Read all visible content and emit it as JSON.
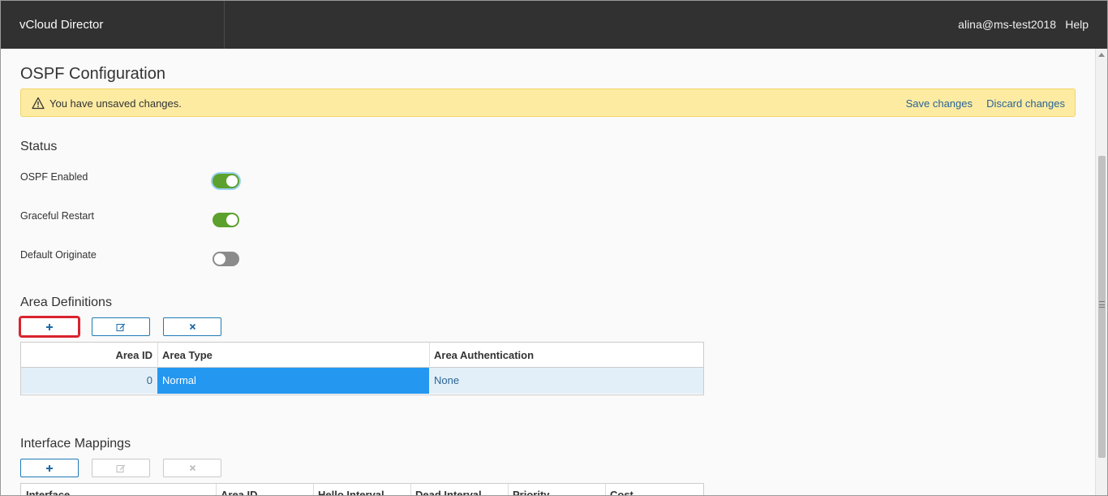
{
  "header": {
    "app_title": "vCloud Director",
    "user": "alina@ms-test2018",
    "help_label": "Help"
  },
  "page": {
    "title": "OSPF Configuration"
  },
  "alert": {
    "message": "You have unsaved changes.",
    "save_label": "Save changes",
    "discard_label": "Discard changes",
    "icon": "warning-icon"
  },
  "status": {
    "title": "Status",
    "ospf_enabled": {
      "label": "OSPF Enabled",
      "on": true
    },
    "graceful_restart": {
      "label": "Graceful Restart",
      "on": true
    },
    "default_originate": {
      "label": "Default Originate",
      "on": false
    }
  },
  "area_definitions": {
    "title": "Area Definitions",
    "columns": [
      "Area ID",
      "Area Type",
      "Area Authentication"
    ],
    "rows": [
      {
        "area_id": "0",
        "area_type": "Normal",
        "area_auth": "None"
      }
    ]
  },
  "interface_mappings": {
    "title": "Interface Mappings",
    "columns": [
      "Interface",
      "Area ID",
      "Hello Interval",
      "Dead Interval",
      "Priority",
      "Cost"
    ]
  },
  "colors": {
    "header_bg": "#313131",
    "toggle_on": "#5ca12d",
    "toggle_off": "#8b8b8b",
    "alert_bg": "#fdeba2",
    "link": "#2a6495",
    "selected_cell": "#2497f0",
    "row_bg": "#e3eff8"
  }
}
